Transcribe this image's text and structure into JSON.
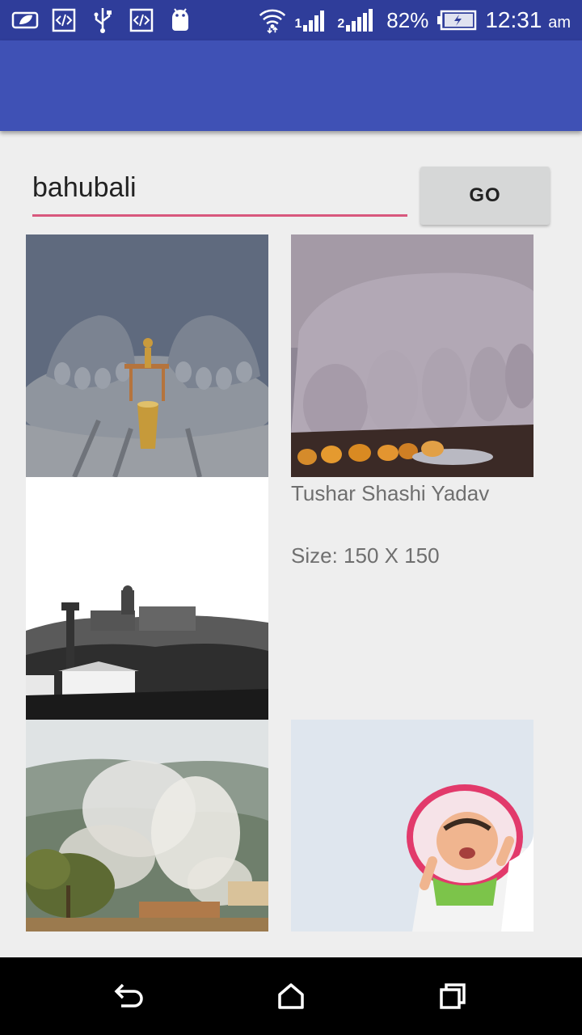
{
  "status_bar": {
    "battery": "82%",
    "time": "12:31",
    "ampm": "am",
    "sim1": "1",
    "sim2": "2"
  },
  "search": {
    "value": "bahubali",
    "go_label": "GO"
  },
  "results": {
    "selected_author": "Tushar Shashi Yadav",
    "selected_size": "Size: 150 X 150"
  },
  "colors": {
    "status_bar": "#2f3d9a",
    "app_bar": "#3f51b5",
    "accent_underline": "#d8577d"
  },
  "icons": [
    "leaf-icon",
    "code-icon",
    "usb-icon",
    "code-icon",
    "android-icon",
    "wifi-icon",
    "signal-icon",
    "battery-icon",
    "back-icon",
    "home-icon",
    "recents-icon"
  ]
}
